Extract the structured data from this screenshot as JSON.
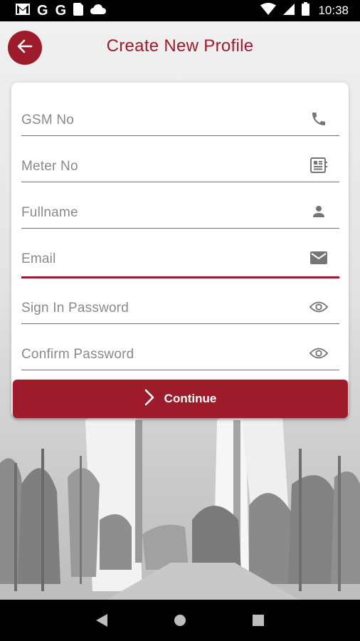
{
  "status_bar": {
    "time": "10:38",
    "left_icons": [
      "gmail-icon",
      "google-icon",
      "google-icon",
      "sim-card-icon",
      "cloud-icon"
    ],
    "right_icons": [
      "wifi-icon",
      "signal-icon",
      "battery-icon"
    ],
    "google_glyph": "G"
  },
  "header": {
    "title": "Create New Profile",
    "back_icon": "arrow-back-icon"
  },
  "form": {
    "fields": [
      {
        "label": "GSM No",
        "icon": "phone-icon"
      },
      {
        "label": "Meter No",
        "icon": "meter-icon"
      },
      {
        "label": "Fullname",
        "icon": "person-icon"
      },
      {
        "label": "Email",
        "icon": "email-icon"
      },
      {
        "label": "Sign In Password",
        "icon": "eye-icon"
      },
      {
        "label": "Confirm Password",
        "icon": "eye-icon"
      }
    ],
    "active_field": "Email",
    "continue_label": "Continue"
  },
  "colors": {
    "accent": "#9e1b2c",
    "icon_gray": "#757575",
    "label_gray": "#8a8a8a"
  },
  "nav": {
    "buttons": [
      "back-triangle-icon",
      "home-circle-icon",
      "recents-square-icon"
    ]
  }
}
